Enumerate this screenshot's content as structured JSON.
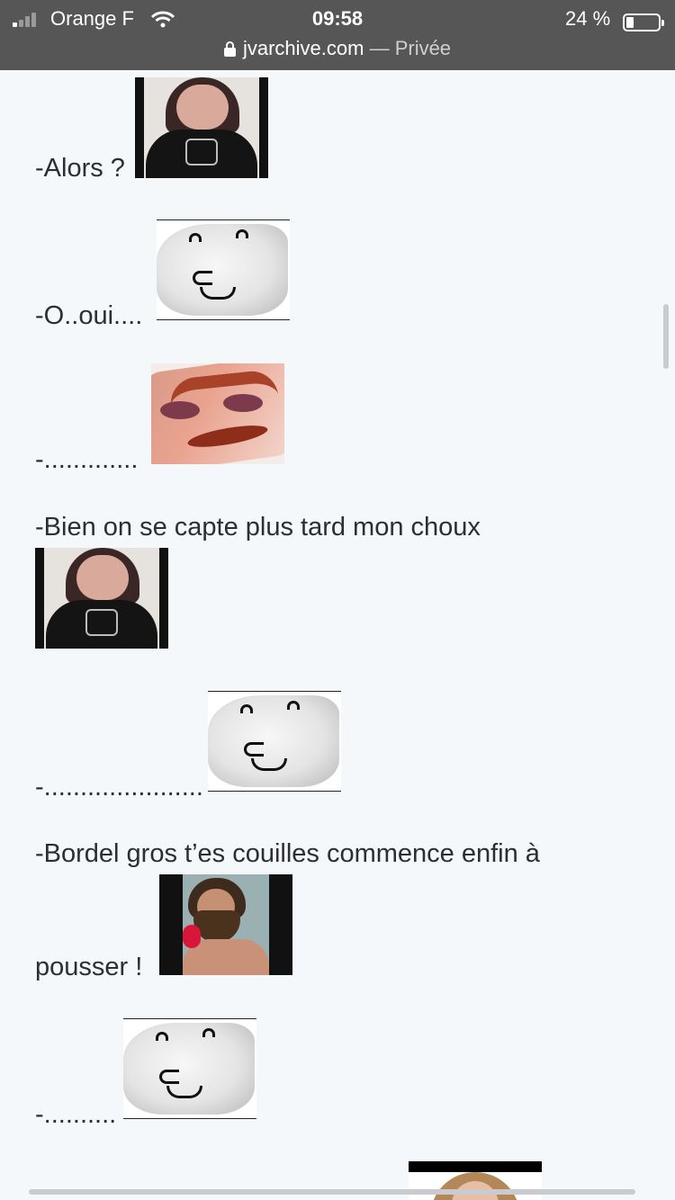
{
  "status_bar": {
    "carrier": "Orange F",
    "time": "09:58",
    "battery_percent": "24 %",
    "battery_level": 0.24
  },
  "url_bar": {
    "domain": "jvarchive.com",
    "separator": "—",
    "mode": "Privée"
  },
  "posts": [
    {
      "text": "-Alors ?",
      "sticker": "man-black-shirt"
    },
    {
      "text": "-O..oui....",
      "sticker": "white-blob-face"
    },
    {
      "text": "-.............",
      "sticker": "angry-closeup-face"
    },
    {
      "text": "-Bien on se capte plus tard mon choux",
      "sticker": "man-black-shirt"
    },
    {
      "text": "-......................",
      "sticker": "white-blob-face"
    },
    {
      "text_line1": "-Bordel gros t’es couilles commence enfin à",
      "text_line2": "pousser !",
      "sticker": "bearded-man"
    },
    {
      "text": "-..........",
      "sticker": "white-blob-face"
    },
    {
      "text": "",
      "sticker": "woman-partial"
    }
  ]
}
